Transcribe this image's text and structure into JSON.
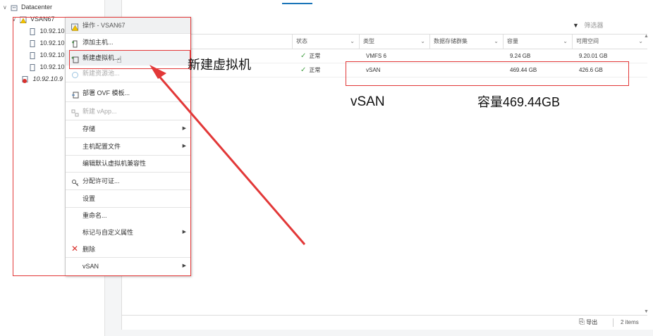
{
  "tree": {
    "datacenter": "Datacenter",
    "cluster": "VSAN67",
    "hosts": [
      "10.92.10",
      "10.92.10",
      "10.92.10",
      "10.92.10"
    ],
    "vm_host": "10.92.10.9"
  },
  "filter": {
    "placeholder": "筛选器"
  },
  "columns": [
    "状态",
    "类型",
    "数据存储群集",
    "容量",
    "可用空间"
  ],
  "rows": [
    {
      "status": "正常",
      "type": "VMFS 6",
      "cluster": "",
      "capacity": "9.24 GB",
      "free": "9.20.01 GB"
    },
    {
      "status": "正常",
      "type": "vSAN",
      "cluster": "",
      "capacity": "469.44 GB",
      "free": "426.6 GB"
    }
  ],
  "footer": {
    "export": "导出",
    "count": "2 items"
  },
  "menu": {
    "header": "操作 - VSAN67",
    "items": [
      {
        "label": "添加主机...",
        "disabled": false,
        "sub": false
      },
      {
        "label": "新建虚拟机...",
        "disabled": false,
        "sub": false
      },
      {
        "label": "新建资源池...",
        "disabled": true,
        "sub": false
      },
      {
        "label": "部署 OVF 模板...",
        "disabled": false,
        "sub": false
      },
      {
        "label": "新建 vApp...",
        "disabled": true,
        "sub": false
      },
      {
        "label": "存储",
        "disabled": false,
        "sub": true
      },
      {
        "label": "主机配置文件",
        "disabled": false,
        "sub": true
      },
      {
        "label": "编辑默认虚拟机兼容性",
        "disabled": false,
        "sub": false
      },
      {
        "label": "分配许可证...",
        "disabled": false,
        "sub": false
      },
      {
        "label": "设置",
        "disabled": false,
        "sub": false
      },
      {
        "label": "重命名...",
        "disabled": false,
        "sub": false
      },
      {
        "label": "标记与自定义属性",
        "disabled": false,
        "sub": true
      },
      {
        "label": "删除",
        "disabled": false,
        "sub": false
      },
      {
        "label": "vSAN",
        "disabled": false,
        "sub": true
      }
    ]
  },
  "annotations": {
    "new_vm": "新建虚拟机",
    "vsan": "vSAN",
    "capacity": "容量469.44GB"
  },
  "colors": {
    "accent": "#1a74b8",
    "annotation_red": "#e23838",
    "ok_green": "#4aa34a"
  }
}
